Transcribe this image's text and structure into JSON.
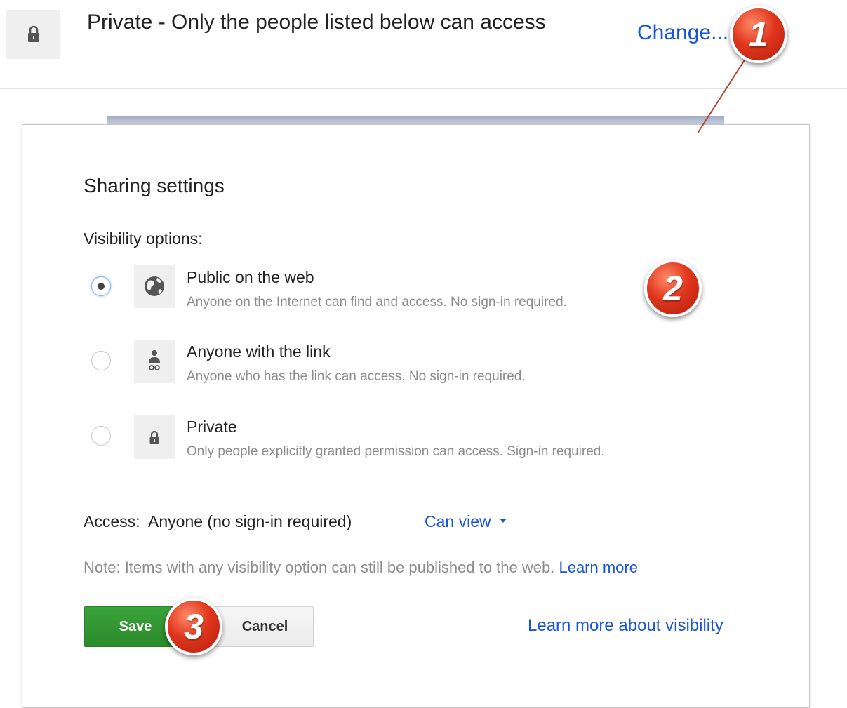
{
  "header": {
    "status": "Private - Only the people listed below can access",
    "change_label": "Change..."
  },
  "dialog": {
    "title": "Sharing settings",
    "visibility_label": "Visibility options:",
    "options": [
      {
        "title": "Public on the web",
        "description": "Anyone on the Internet can find and access. No sign-in required.",
        "icon": "globe-icon",
        "selected": true
      },
      {
        "title": "Anyone with the link",
        "description": "Anyone who has the link can access. No sign-in required.",
        "icon": "person-link-icon",
        "selected": false
      },
      {
        "title": "Private",
        "description": "Only people explicitly granted permission can access. Sign-in required.",
        "icon": "lock-icon",
        "selected": false
      }
    ],
    "access_label": "Access:  Anyone (no sign-in required)",
    "permission_value": "Can view",
    "note_text": "Note: Items with any visibility option can still be published to the web.",
    "note_link": "Learn more",
    "save_label": "Save",
    "cancel_label": "Cancel",
    "learn_visibility_label": "Learn more about visibility"
  },
  "callouts": [
    "1",
    "2",
    "3"
  ],
  "colors": {
    "link": "#1a55d8",
    "save_button": "#2b8a2b",
    "callout_red": "#e0361c",
    "muted_text": "#8c8c8c"
  }
}
